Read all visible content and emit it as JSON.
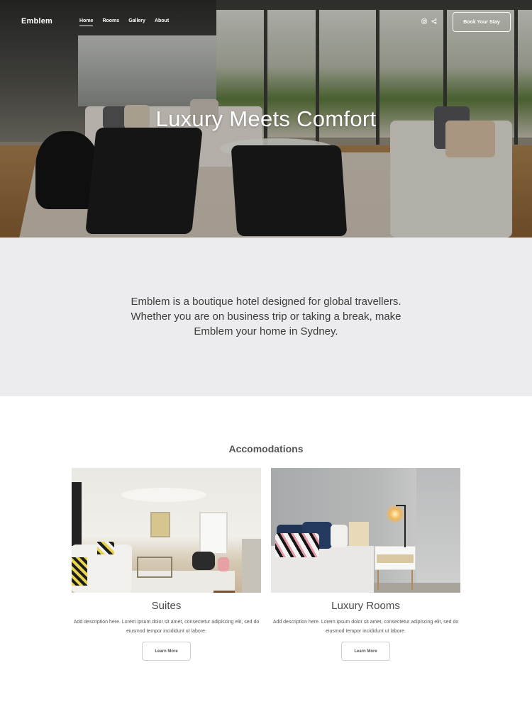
{
  "nav": {
    "brand": "Emblem",
    "links": [
      {
        "label": "Home",
        "active": true
      },
      {
        "label": "Rooms",
        "active": false
      },
      {
        "label": "Gallery",
        "active": false
      },
      {
        "label": "About",
        "active": false
      }
    ],
    "social_icons": [
      "instagram-icon",
      "share-icon"
    ],
    "cta_label": "Book Your Stay"
  },
  "hero": {
    "title": "Luxury Meets Comfort"
  },
  "intro": {
    "text": "Emblem is a boutique hotel designed for global travellers. Whether you are on business trip or taking a break, make Emblem your home in Sydney."
  },
  "accommodations": {
    "title": "Accomodations",
    "cards": [
      {
        "name": "Suites",
        "description": "Add description here. Lorem ipsum dolor sit amet, consectetur adipiscing elit, sed do eiusmod tempor incididunt ut labore.",
        "button_label": "Learn More"
      },
      {
        "name": "Luxury Rooms",
        "description": "Add description here. Lorem ipsum dolor sit amet, consectetur adipiscing elit, sed do eiusmod tempor incididunt ut labore.",
        "button_label": "Learn More"
      }
    ]
  },
  "colors": {
    "intro_background": "#ececee",
    "text_dark": "#3c3c3c",
    "hero_text": "#ffffff"
  }
}
